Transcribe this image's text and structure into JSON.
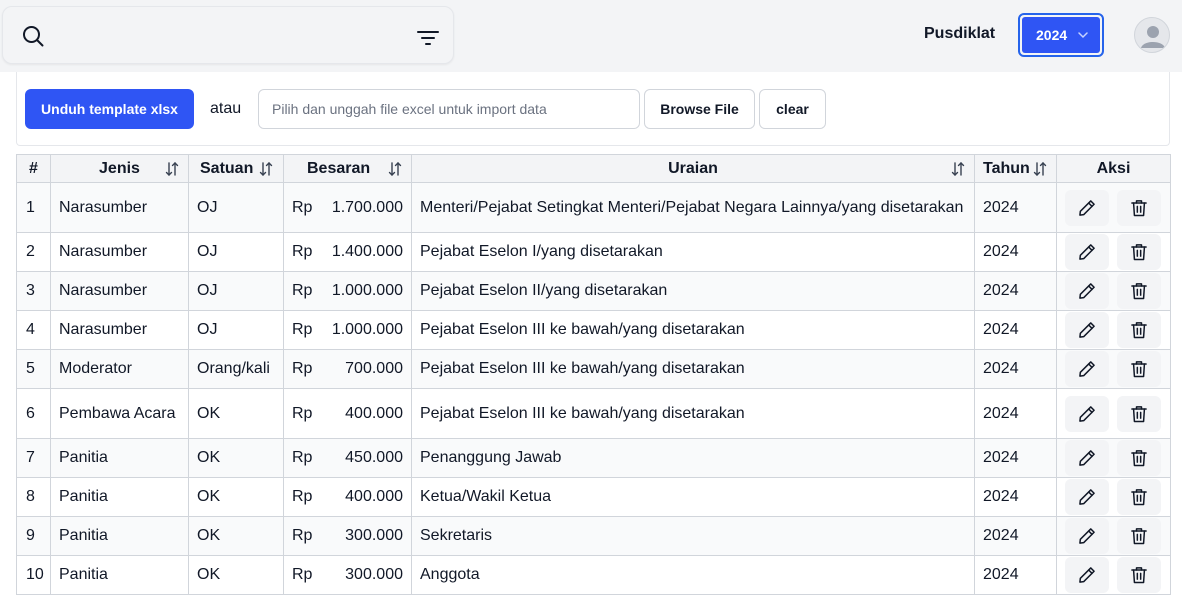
{
  "header": {
    "search_placeholder": "",
    "org_label": "Pusdiklat",
    "year_selected": "2024"
  },
  "import": {
    "download_label": "Unduh template xlsx",
    "or_label": "atau",
    "file_placeholder": "Pilih dan unggah file excel untuk import data",
    "browse_label": "Browse File",
    "clear_label": "clear"
  },
  "table": {
    "headers": {
      "no": "#",
      "jenis": "Jenis",
      "satuan": "Satuan",
      "besaran": "Besaran",
      "uraian": "Uraian",
      "tahun": "Tahun",
      "aksi": "Aksi"
    },
    "rows": [
      {
        "no": "1",
        "jenis": "Narasumber",
        "satuan": "OJ",
        "currency": "Rp",
        "besaran": "1.700.000",
        "uraian": "Menteri/Pejabat Setingkat Menteri/Pejabat Negara Lainnya/yang disetarakan",
        "tahun": "2024"
      },
      {
        "no": "2",
        "jenis": "Narasumber",
        "satuan": "OJ",
        "currency": "Rp",
        "besaran": "1.400.000",
        "uraian": "Pejabat Eselon I/yang disetarakan",
        "tahun": "2024"
      },
      {
        "no": "3",
        "jenis": "Narasumber",
        "satuan": "OJ",
        "currency": "Rp",
        "besaran": "1.000.000",
        "uraian": "Pejabat Eselon II/yang disetarakan",
        "tahun": "2024"
      },
      {
        "no": "4",
        "jenis": "Narasumber",
        "satuan": "OJ",
        "currency": "Rp",
        "besaran": "1.000.000",
        "uraian": "Pejabat Eselon III ke bawah/yang disetarakan",
        "tahun": "2024"
      },
      {
        "no": "5",
        "jenis": "Moderator",
        "satuan": "Orang/kali",
        "currency": "Rp",
        "besaran": "700.000",
        "uraian": "Pejabat Eselon III ke bawah/yang disetarakan",
        "tahun": "2024"
      },
      {
        "no": "6",
        "jenis": "Pembawa Acara",
        "satuan": "OK",
        "currency": "Rp",
        "besaran": "400.000",
        "uraian": "Pejabat Eselon III ke bawah/yang disetarakan",
        "tahun": "2024"
      },
      {
        "no": "7",
        "jenis": "Panitia",
        "satuan": "OK",
        "currency": "Rp",
        "besaran": "450.000",
        "uraian": "Penanggung Jawab",
        "tahun": "2024"
      },
      {
        "no": "8",
        "jenis": "Panitia",
        "satuan": "OK",
        "currency": "Rp",
        "besaran": "400.000",
        "uraian": "Ketua/Wakil Ketua",
        "tahun": "2024"
      },
      {
        "no": "9",
        "jenis": "Panitia",
        "satuan": "OK",
        "currency": "Rp",
        "besaran": "300.000",
        "uraian": "Sekretaris",
        "tahun": "2024"
      },
      {
        "no": "10",
        "jenis": "Panitia",
        "satuan": "OK",
        "currency": "Rp",
        "besaran": "300.000",
        "uraian": "Anggota",
        "tahun": "2024"
      }
    ]
  },
  "icons": {
    "search": "search-icon",
    "filter": "filter-icon",
    "chevron": "chevron-down-icon",
    "avatar": "user-avatar-icon",
    "sort": "sort-icon",
    "edit": "pencil-icon",
    "delete": "trash-icon"
  },
  "colors": {
    "accent": "#2f55f4",
    "focus_ring": "#2563eb"
  }
}
